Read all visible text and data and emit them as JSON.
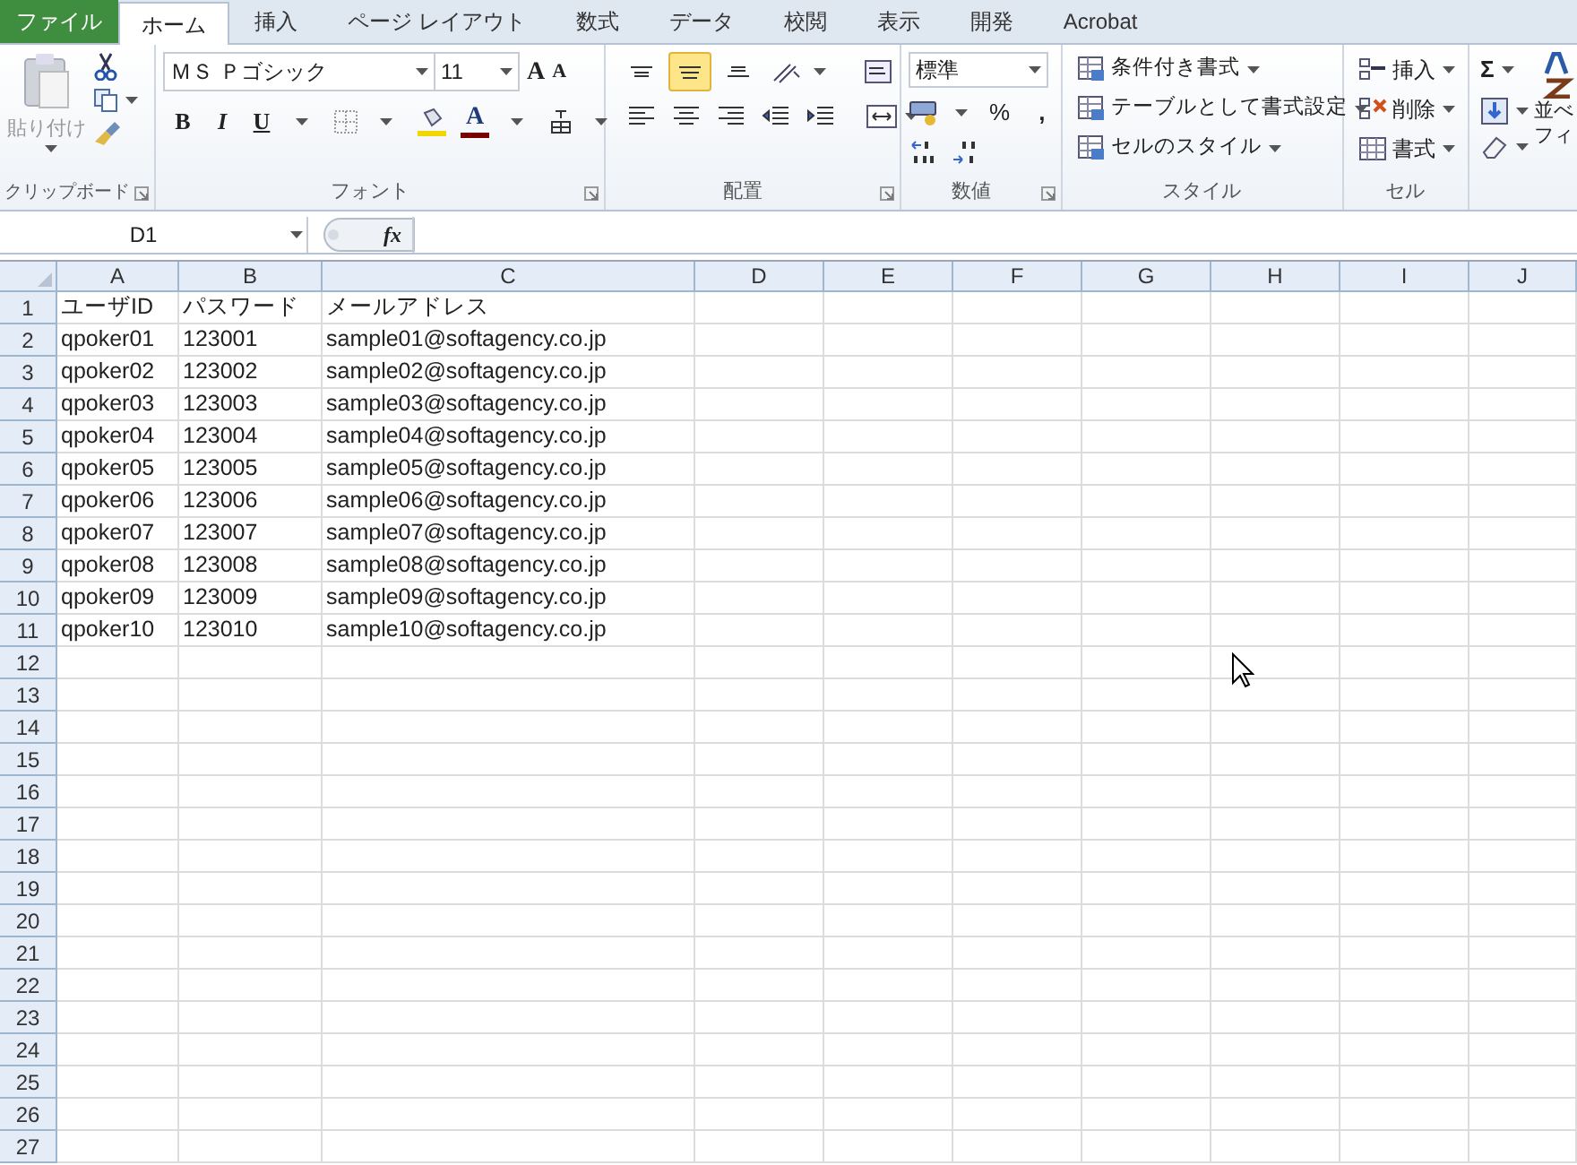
{
  "tabs": [
    {
      "label": "ファイル",
      "kind": "file",
      "selected": false
    },
    {
      "label": "ホーム",
      "kind": "normal",
      "selected": true
    },
    {
      "label": "挿入",
      "kind": "normal",
      "selected": false
    },
    {
      "label": "ページ レイアウト",
      "kind": "normal",
      "selected": false
    },
    {
      "label": "数式",
      "kind": "normal",
      "selected": false
    },
    {
      "label": "データ",
      "kind": "normal",
      "selected": false
    },
    {
      "label": "校閲",
      "kind": "normal",
      "selected": false
    },
    {
      "label": "表示",
      "kind": "normal",
      "selected": false
    },
    {
      "label": "開発",
      "kind": "normal",
      "selected": false
    },
    {
      "label": "Acrobat",
      "kind": "normal",
      "selected": false
    }
  ],
  "clipboard": {
    "paste_label": "貼り付け",
    "group_label": "クリップボード"
  },
  "font": {
    "font_name": "ＭＳ Ｐゴシック",
    "font_size": "11",
    "grow_label": "A",
    "shrink_label": "A",
    "style_buttons": [
      "B",
      "I",
      "U"
    ],
    "font_color_label": "A",
    "group_label": "フォント"
  },
  "alignment": {
    "vertical": [
      {
        "selected": false
      },
      {
        "selected": true
      },
      {
        "selected": false
      }
    ],
    "group_label": "配置"
  },
  "number": {
    "format": "標準",
    "percent": "%",
    "comma": ",",
    "group_label": "数値"
  },
  "styles": {
    "items": [
      "条件付き書式",
      "テーブルとして書式設定",
      "セルのスタイル"
    ],
    "group_label": "スタイル"
  },
  "cells": {
    "items": [
      "挿入",
      "削除",
      "書式"
    ],
    "group_label": "セル"
  },
  "editing": {
    "sum": "Σ",
    "sort_lines": [
      "並べ",
      "フィ"
    ]
  },
  "formula_bar": {
    "name_box": "D1",
    "fx": "fx"
  },
  "sheet": {
    "columns": [
      "A",
      "B",
      "C",
      "D",
      "E",
      "F",
      "G",
      "H",
      "I",
      "J"
    ],
    "rows": [
      {
        "number": "1",
        "cells": [
          "ユーザID",
          "パスワード",
          "メールアドレス"
        ]
      },
      {
        "number": "2",
        "cells": [
          "qpoker01",
          "123001",
          "sample01@softagency.co.jp"
        ]
      },
      {
        "number": "3",
        "cells": [
          "qpoker02",
          "123002",
          "sample02@softagency.co.jp"
        ]
      },
      {
        "number": "4",
        "cells": [
          "qpoker03",
          "123003",
          "sample03@softagency.co.jp"
        ]
      },
      {
        "number": "5",
        "cells": [
          "qpoker04",
          "123004",
          "sample04@softagency.co.jp"
        ]
      },
      {
        "number": "6",
        "cells": [
          "qpoker05",
          "123005",
          "sample05@softagency.co.jp"
        ]
      },
      {
        "number": "7",
        "cells": [
          "qpoker06",
          "123006",
          "sample06@softagency.co.jp"
        ]
      },
      {
        "number": "8",
        "cells": [
          "qpoker07",
          "123007",
          "sample07@softagency.co.jp"
        ]
      },
      {
        "number": "9",
        "cells": [
          "qpoker08",
          "123008",
          "sample08@softagency.co.jp"
        ]
      },
      {
        "number": "10",
        "cells": [
          "qpoker09",
          "123009",
          "sample09@softagency.co.jp"
        ]
      },
      {
        "number": "11",
        "cells": [
          "qpoker10",
          "123010",
          "sample10@softagency.co.jp"
        ]
      },
      {
        "number": "12"
      },
      {
        "number": "13"
      },
      {
        "number": "14"
      },
      {
        "number": "15"
      },
      {
        "number": "16"
      },
      {
        "number": "17"
      },
      {
        "number": "18"
      },
      {
        "number": "19"
      },
      {
        "number": "20"
      },
      {
        "number": "21"
      },
      {
        "number": "22"
      },
      {
        "number": "23"
      },
      {
        "number": "24"
      },
      {
        "number": "25"
      },
      {
        "number": "26"
      },
      {
        "number": "27"
      }
    ]
  }
}
